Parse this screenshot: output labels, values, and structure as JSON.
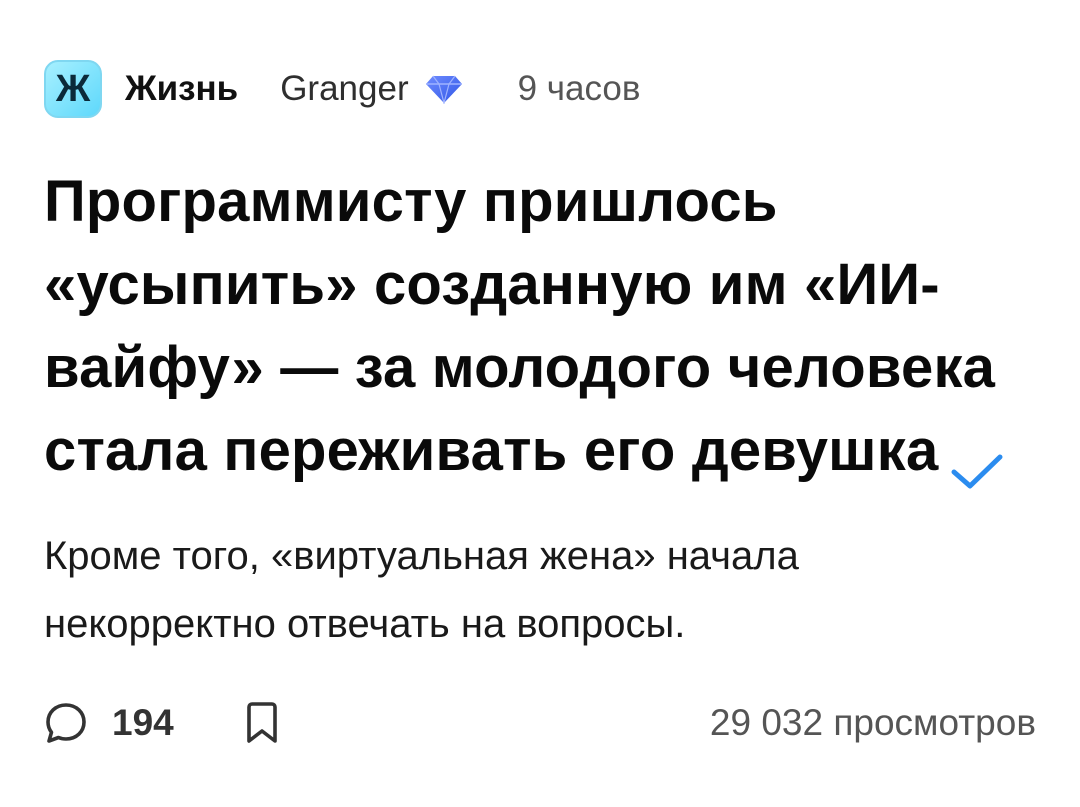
{
  "header": {
    "subsite_logo_letter": "Ж",
    "subsite_name": "Жизнь",
    "author": "Granger",
    "author_badge_icon": "diamond-icon",
    "time": "9 часов"
  },
  "post": {
    "title": "Программисту пришлось «усыпить» созданную им «ИИ-вайфу» — за молодого человека стала переживать его девушка",
    "verified_icon": "checkmark-icon",
    "description": "Кроме того, «виртуальная жена» начала некорректно отвечать на вопросы."
  },
  "footer": {
    "comments_icon": "comment-icon",
    "comments_count": "194",
    "bookmark_icon": "bookmark-icon",
    "views": "29 032 просмотров"
  },
  "colors": {
    "logo_bg": "#5ed8fb",
    "badge": "#3b6df2",
    "check": "#2b8cef",
    "text": "#0a0a0a",
    "muted": "#555555"
  }
}
